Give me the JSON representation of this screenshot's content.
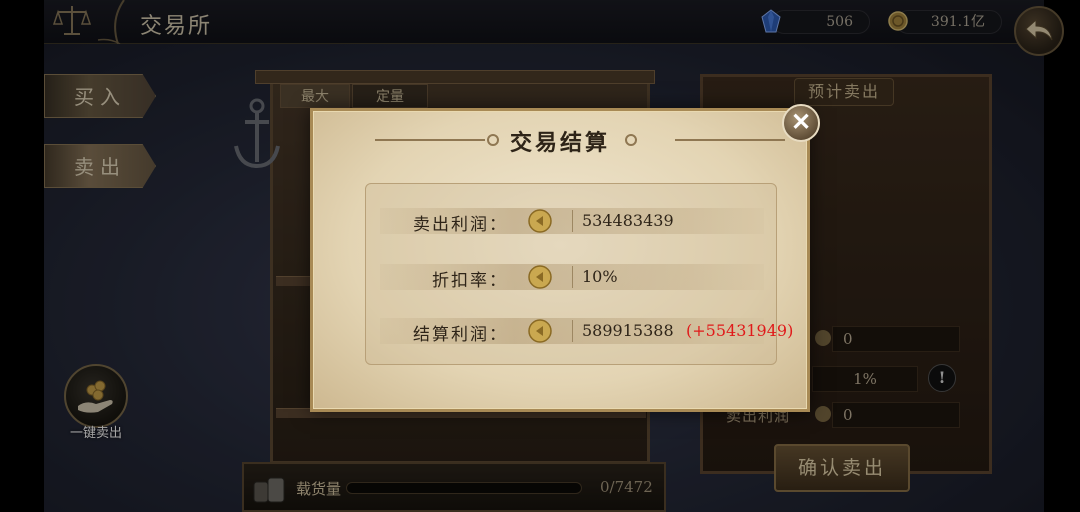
{
  "header": {
    "title": "交易所",
    "gems": "506",
    "coins": "391.1亿"
  },
  "left_tabs": [
    {
      "label": "买入"
    },
    {
      "label": "卖出"
    }
  ],
  "quick_sell": {
    "label": "一键卖出"
  },
  "cabinet": {
    "tabs": [
      {
        "label": "最大"
      },
      {
        "label": "定量"
      }
    ],
    "cargo_label": "载货量",
    "cargo_value": "0/7472",
    "cargo_fill": 0
  },
  "right_panel": {
    "title": "预计卖出",
    "field_1": "0",
    "field_2": "1%",
    "field_3": "0",
    "sell_profit_label": "卖出利润",
    "confirm_label": "确认卖出"
  },
  "dialog": {
    "title": "交易结算",
    "close_glyph": "✕",
    "rows": [
      {
        "label": "卖出利润：",
        "value": "534483439"
      },
      {
        "label": "折扣率：",
        "value": "10%"
      },
      {
        "label": "结算利润：",
        "value": "589915388",
        "bonus": "(+55431949)"
      }
    ]
  },
  "colors": {
    "bonus": "#e01a1a",
    "parchment": "#e3d4b3",
    "title_text": "#d8cdb2"
  },
  "icons": [
    "scale-icon",
    "gem-icon",
    "coin-icon",
    "back-arrow-icon",
    "anchor-icon",
    "quick-sell-icon",
    "cargo-icon",
    "info-icon",
    "close-icon"
  ]
}
